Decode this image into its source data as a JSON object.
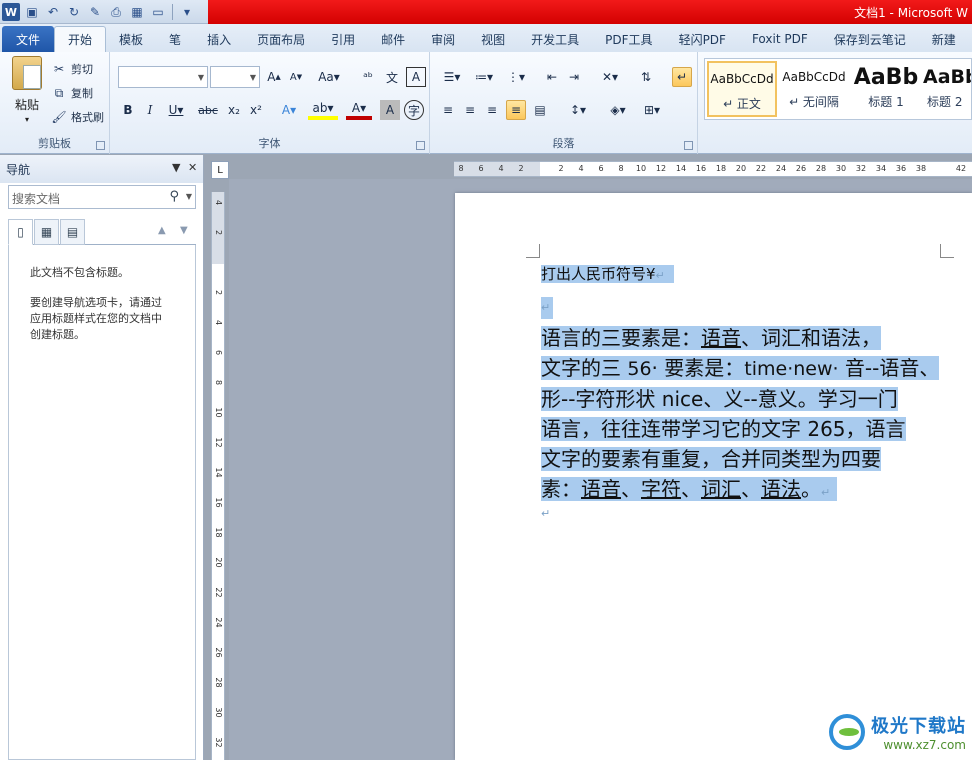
{
  "title": "文档1 - Microsoft W",
  "qat_icons": [
    "word-icon",
    "save-icon",
    "undo-icon",
    "redo-icon",
    "edit-icon",
    "print-icon",
    "layout-icon",
    "book-icon",
    "more-icon"
  ],
  "tabs": [
    "文件",
    "开始",
    "模板",
    "笔",
    "插入",
    "页面布局",
    "引用",
    "邮件",
    "审阅",
    "视图",
    "开发工具",
    "PDF工具",
    "轻闪PDF",
    "Foxit PDF",
    "保存到云笔记",
    "新建"
  ],
  "ribbon": {
    "clipboard": {
      "paste": "粘贴",
      "cut": "剪切",
      "copy": "复制",
      "format_painter": "格式刷",
      "label": "剪贴板"
    },
    "font": {
      "label": "字体",
      "font_name": "",
      "font_size": ""
    },
    "paragraph": {
      "label": "段落"
    },
    "styles": [
      {
        "preview": "AaBbCcDd",
        "name": "↵ 正文"
      },
      {
        "preview": "AaBbCcDd",
        "name": "↵ 无间隔"
      },
      {
        "preview": "AaBb",
        "name": "标题 1"
      },
      {
        "preview": "AaBb",
        "name": "标题 2"
      }
    ]
  },
  "nav": {
    "title": "导航",
    "search_placeholder": "搜索文档",
    "msg1": "此文档不包含标题。",
    "msg2_l1": "要创建导航选项卡，请通过",
    "msg2_l2": "应用标题样式在您的文档中",
    "msg2_l3": "创建标题。"
  },
  "ruler": {
    "h": [
      "8",
      "6",
      "4",
      "2",
      "",
      "2",
      "4",
      "6",
      "8",
      "10",
      "12",
      "14",
      "16",
      "18",
      "20",
      "22",
      "24",
      "26",
      "28",
      "30",
      "32",
      "34",
      "36",
      "38",
      "",
      "42"
    ],
    "v": [
      "4",
      "2",
      "",
      "2",
      "4",
      "6",
      "8",
      "10",
      "12",
      "14",
      "16",
      "18",
      "20",
      "22",
      "24",
      "26",
      "28",
      "30",
      "32"
    ]
  },
  "document": {
    "para1": "打出人民币符号¥",
    "para_mark": "↵",
    "p3": {
      "l1_a": "语言的三要素是：",
      "l1_u": "语音",
      "l1_b": "、词汇和语法，",
      "l2_a": "文字的三 ",
      "l2_n": "56",
      "l2_b": "· 要素是：",
      "l2_c": "time·new·",
      "l2_d": " 音--语音、",
      "l3": "形--字符形状 nice、义--意义。学习一门",
      "l4": "语言，往往连带学习它的文字 265，语言",
      "l5": "文字的要素有重复，合并同类型为四要",
      "l6_a": "素：",
      "l6_u1": "语音",
      "l6_s1": "、",
      "l6_u2": "字符",
      "l6_s2": "、",
      "l6_u3": "词汇",
      "l6_s3": "、",
      "l6_u4": "语法",
      "l6_end": "。"
    }
  },
  "watermark": {
    "name": "极光下载站",
    "url": "www.xz7.com"
  },
  "colors": {
    "titlebar_red": "#e01010",
    "selection": "#a9cbee",
    "file_tab": "#2b62b5",
    "accent_yellow": "#fcc75b"
  }
}
